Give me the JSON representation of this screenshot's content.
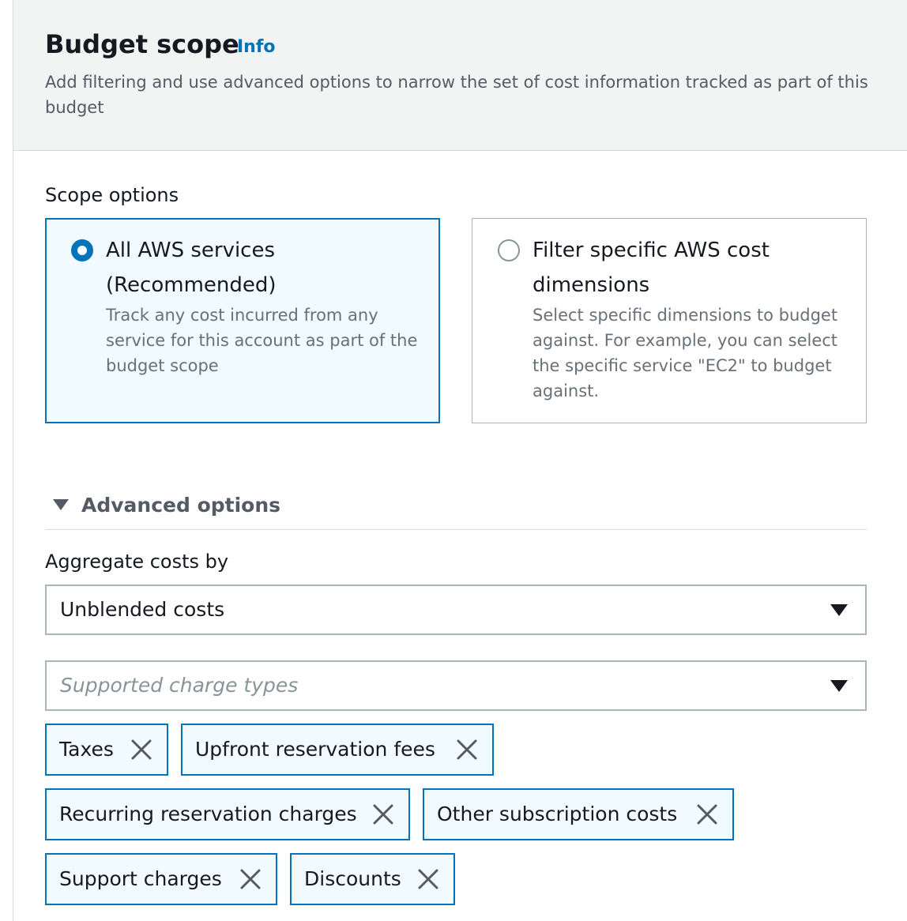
{
  "header": {
    "title": "Budget scope",
    "info_label": "Info",
    "description": "Add filtering and use advanced options to narrow the set of cost information tracked as part of this budget"
  },
  "scope": {
    "label": "Scope options",
    "options": [
      {
        "title": "All AWS services (Recommended)",
        "description": "Track any cost incurred from any service for this account as part of the budget scope",
        "selected": true
      },
      {
        "title": "Filter specific AWS cost dimensions",
        "description": "Select specific dimensions to budget against. For example, you can select the specific service \"EC2\" to budget against.",
        "selected": false
      }
    ]
  },
  "advanced": {
    "label": "Advanced options",
    "expanded": true,
    "aggregate_label": "Aggregate costs by",
    "aggregate_value": "Unblended costs",
    "charge_types_placeholder": "Supported charge types",
    "tokens": [
      "Taxes",
      "Upfront reservation fees",
      "Recurring reservation charges",
      "Other subscription costs",
      "Support charges",
      "Discounts"
    ]
  },
  "colors": {
    "accent": "#0073bb",
    "selected_bg": "#f1faff",
    "header_bg": "#f2f3f3"
  },
  "icons": {
    "info": "info-link",
    "remove": "close-icon",
    "expand": "caret-down-icon",
    "dropdown": "caret-down-icon"
  }
}
